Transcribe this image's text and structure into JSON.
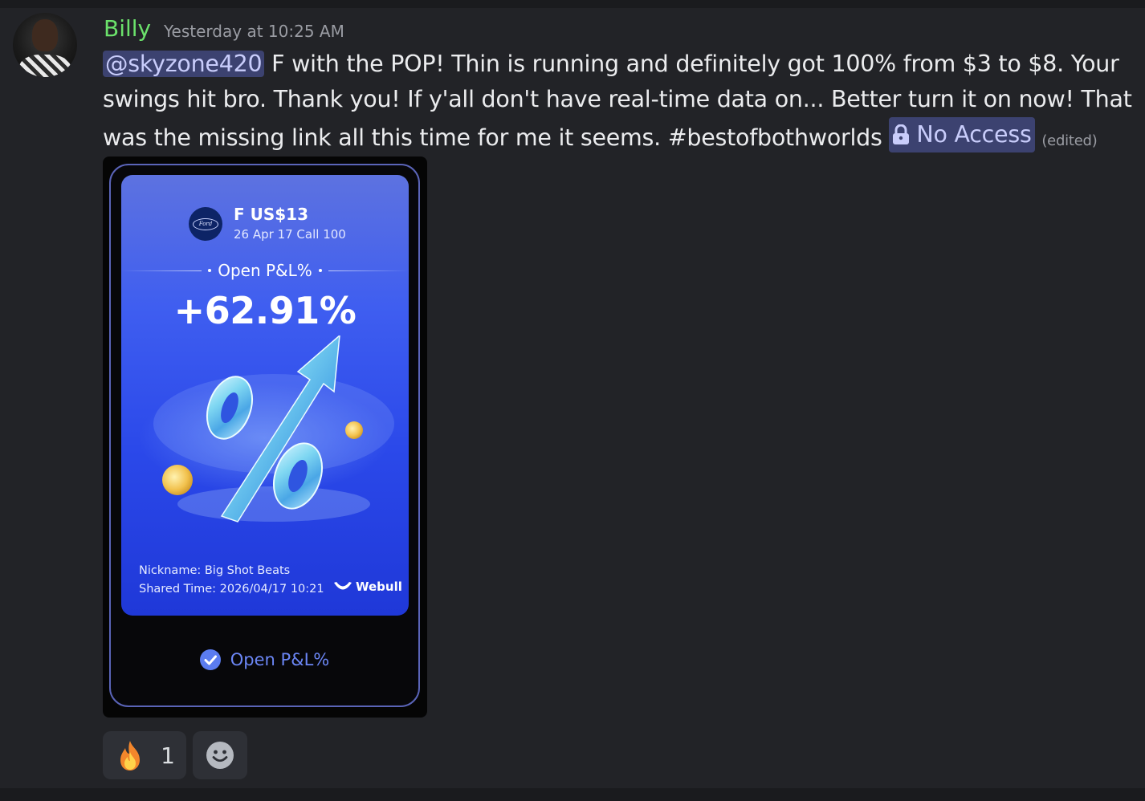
{
  "message": {
    "author": "Billy",
    "timestamp": "Yesterday at 10:25 AM",
    "mention": "@skyzone420",
    "text": " F with the POP! Thin is running and definitely got 100% from $3 to $8. Your swings hit bro. Thank you! If y'all don't have real-time data on... Better turn it on now! That was the missing link all this time for me it seems. #bestofbothworlds ",
    "channel_link": "No Access",
    "edited": "(edited)"
  },
  "card": {
    "logo_text": "Ford",
    "ticker": "F US$13",
    "contract": "26 Apr 17 Call 100",
    "pl_label": "Open P&L%",
    "pl_value": "+62.91%",
    "nickname": "Nickname: Big Shot Beats",
    "shared_time": "Shared Time: 2026/04/17 10:21",
    "brand": "Webull"
  },
  "embed_footer": {
    "label": "Open P&L%"
  },
  "reactions": [
    {
      "emoji": "fire-icon",
      "count": "1"
    }
  ],
  "colors": {
    "background": "#222327",
    "author": "#6be16b",
    "mention_bg": "#3c4270",
    "mention_fg": "#c9cdfb",
    "accent_blue": "#6b86f5"
  }
}
